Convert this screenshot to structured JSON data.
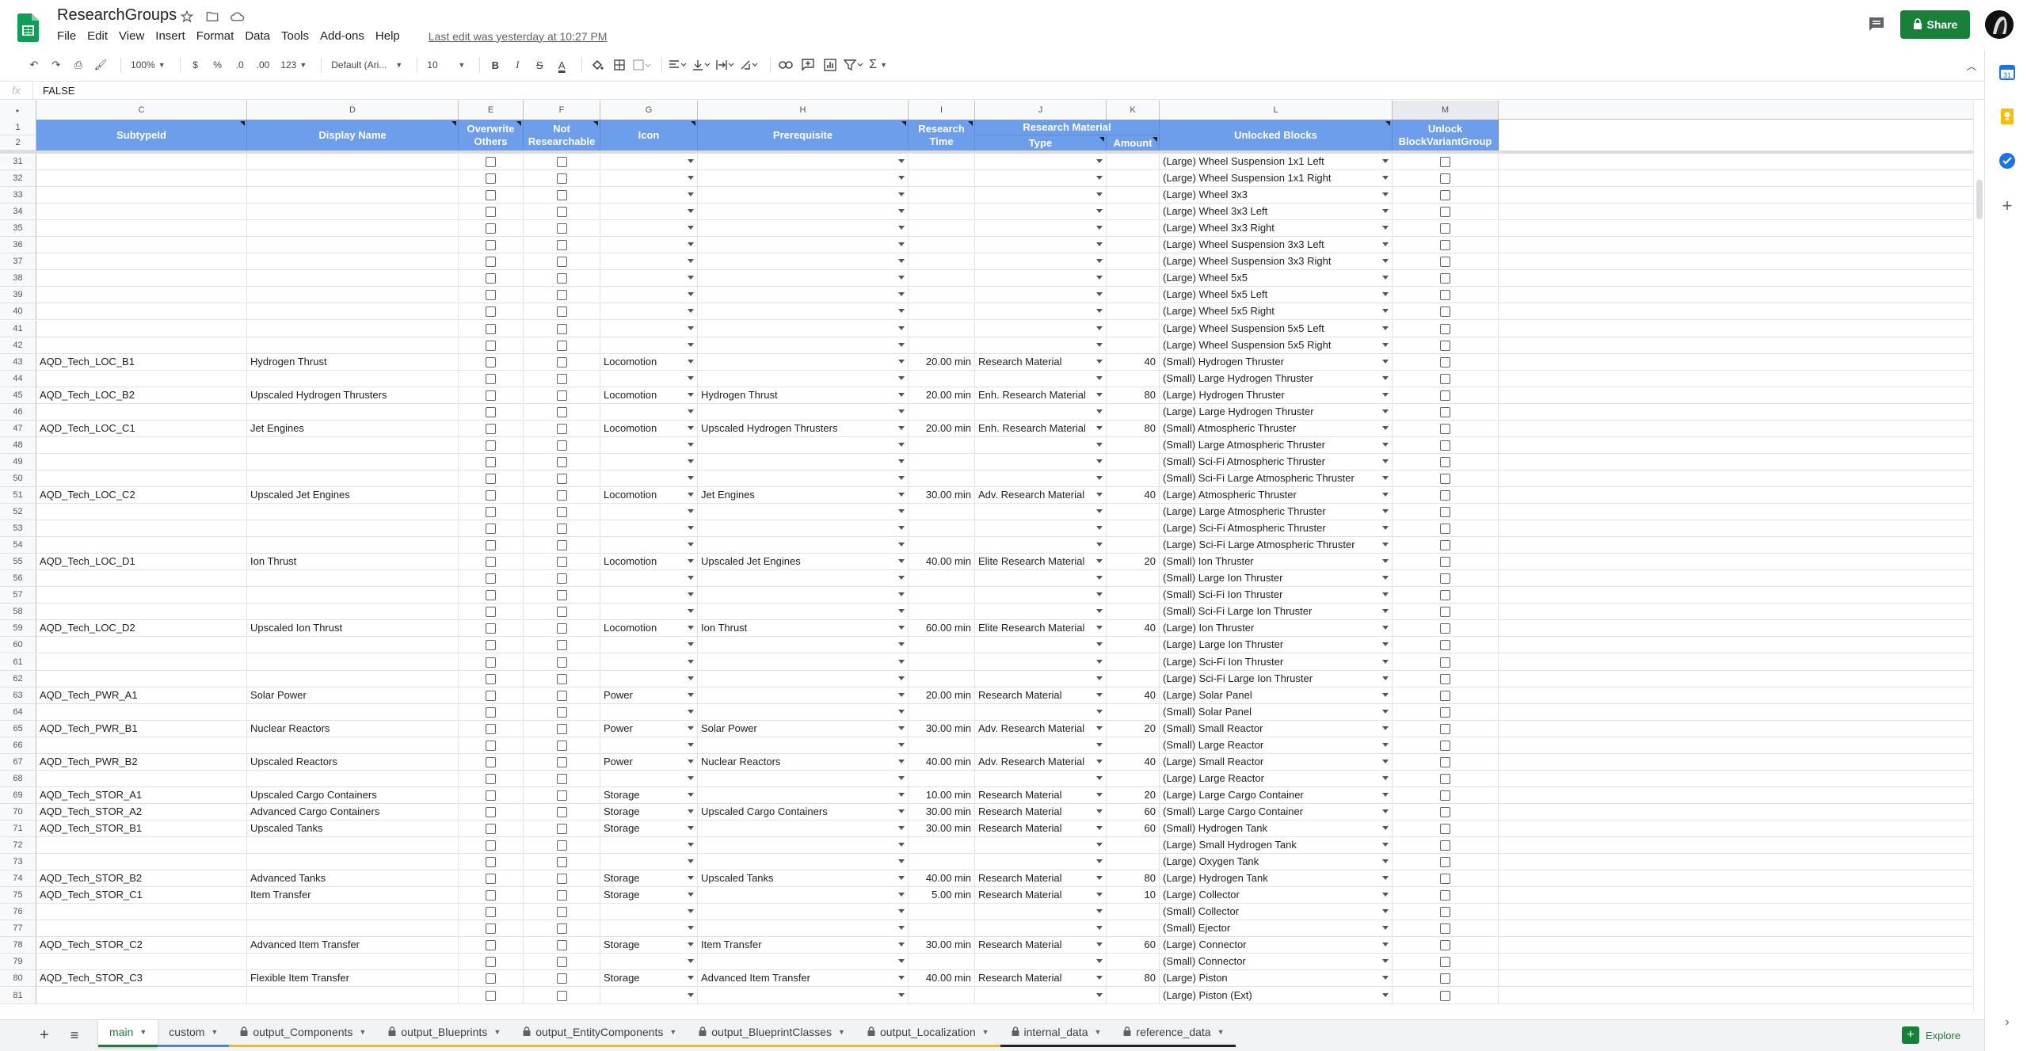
{
  "doc": {
    "title": "ResearchGroups",
    "last_edit": "Last edit was yesterday at 10:27 PM",
    "share_label": "Share"
  },
  "menu": [
    "File",
    "Edit",
    "View",
    "Insert",
    "Format",
    "Data",
    "Tools",
    "Add-ons",
    "Help"
  ],
  "toolbar": {
    "zoom": "100%",
    "currency": "$",
    "percent": "%",
    "dec_less": ".0",
    "dec_more": ".00",
    "more_formats": "123",
    "font": "Default (Ari...",
    "font_size": "10"
  },
  "formula": {
    "fx": "fx",
    "value": "FALSE"
  },
  "columns": [
    "C",
    "D",
    "E",
    "F",
    "G",
    "H",
    "I",
    "J",
    "K",
    "L",
    "M"
  ],
  "headers": {
    "subtype": "SubtypeId",
    "display": "Display Name",
    "overwrite": [
      "Overwrite",
      "Others"
    ],
    "notres": [
      "Not",
      "Researchable"
    ],
    "icon": "Icon",
    "prereq": "Prerequisite",
    "time": [
      "Research",
      "Time"
    ],
    "material_group": "Research Material",
    "type": "Type",
    "amount": "Amount",
    "unlocked": "Unlocked Blocks",
    "unlock_group": [
      "Unlock",
      "BlockVariantGroup"
    ]
  },
  "rows": [
    {
      "n": "31",
      "c": "",
      "d": "",
      "g": "",
      "h": "",
      "i": "",
      "j": "",
      "k": "",
      "l": "(Large) Wheel Suspension 1x1 Left"
    },
    {
      "n": "32",
      "c": "",
      "d": "",
      "g": "",
      "h": "",
      "i": "",
      "j": "",
      "k": "",
      "l": "(Large) Wheel Suspension 1x1 Right"
    },
    {
      "n": "33",
      "c": "",
      "d": "",
      "g": "",
      "h": "",
      "i": "",
      "j": "",
      "k": "",
      "l": "(Large) Wheel 3x3"
    },
    {
      "n": "34",
      "c": "",
      "d": "",
      "g": "",
      "h": "",
      "i": "",
      "j": "",
      "k": "",
      "l": "(Large) Wheel 3x3 Left"
    },
    {
      "n": "35",
      "c": "",
      "d": "",
      "g": "",
      "h": "",
      "i": "",
      "j": "",
      "k": "",
      "l": "(Large) Wheel 3x3 Right"
    },
    {
      "n": "36",
      "c": "",
      "d": "",
      "g": "",
      "h": "",
      "i": "",
      "j": "",
      "k": "",
      "l": "(Large) Wheel Suspension 3x3 Left"
    },
    {
      "n": "37",
      "c": "",
      "d": "",
      "g": "",
      "h": "",
      "i": "",
      "j": "",
      "k": "",
      "l": "(Large) Wheel Suspension 3x3 Right"
    },
    {
      "n": "38",
      "c": "",
      "d": "",
      "g": "",
      "h": "",
      "i": "",
      "j": "",
      "k": "",
      "l": "(Large) Wheel 5x5"
    },
    {
      "n": "39",
      "c": "",
      "d": "",
      "g": "",
      "h": "",
      "i": "",
      "j": "",
      "k": "",
      "l": "(Large) Wheel 5x5 Left"
    },
    {
      "n": "40",
      "c": "",
      "d": "",
      "g": "",
      "h": "",
      "i": "",
      "j": "",
      "k": "",
      "l": "(Large) Wheel 5x5 Right"
    },
    {
      "n": "41",
      "c": "",
      "d": "",
      "g": "",
      "h": "",
      "i": "",
      "j": "",
      "k": "",
      "l": "(Large) Wheel Suspension 5x5 Left"
    },
    {
      "n": "42",
      "c": "",
      "d": "",
      "g": "",
      "h": "",
      "i": "",
      "j": "",
      "k": "",
      "l": "(Large) Wheel Suspension 5x5 Right"
    },
    {
      "n": "43",
      "c": "AQD_Tech_LOC_B1",
      "d": "Hydrogen Thrust",
      "g": "Locomotion",
      "h": "",
      "i": "20.00 min",
      "j": "Research Material",
      "k": "40",
      "l": "(Small) Hydrogen Thruster"
    },
    {
      "n": "44",
      "c": "",
      "d": "",
      "g": "",
      "h": "",
      "i": "",
      "j": "",
      "k": "",
      "l": "(Small) Large Hydrogen Thruster"
    },
    {
      "n": "45",
      "c": "AQD_Tech_LOC_B2",
      "d": "Upscaled Hydrogen Thrusters",
      "g": "Locomotion",
      "h": "Hydrogen Thrust",
      "i": "20.00 min",
      "j": "Enh. Research Material",
      "k": "80",
      "l": "(Large) Hydrogen Thruster"
    },
    {
      "n": "46",
      "c": "",
      "d": "",
      "g": "",
      "h": "",
      "i": "",
      "j": "",
      "k": "",
      "l": "(Large) Large Hydrogen Thruster"
    },
    {
      "n": "47",
      "c": "AQD_Tech_LOC_C1",
      "d": "Jet Engines",
      "g": "Locomotion",
      "h": "Upscaled Hydrogen Thrusters",
      "i": "20.00 min",
      "j": "Enh. Research Material",
      "k": "80",
      "l": "(Small) Atmospheric Thruster"
    },
    {
      "n": "48",
      "c": "",
      "d": "",
      "g": "",
      "h": "",
      "i": "",
      "j": "",
      "k": "",
      "l": "(Small) Large Atmospheric Thruster"
    },
    {
      "n": "49",
      "c": "",
      "d": "",
      "g": "",
      "h": "",
      "i": "",
      "j": "",
      "k": "",
      "l": "(Small) Sci-Fi Atmospheric Thruster"
    },
    {
      "n": "50",
      "c": "",
      "d": "",
      "g": "",
      "h": "",
      "i": "",
      "j": "",
      "k": "",
      "l": "(Small) Sci-Fi Large Atmospheric Thruster"
    },
    {
      "n": "51",
      "c": "AQD_Tech_LOC_C2",
      "d": "Upscaled Jet Engines",
      "g": "Locomotion",
      "h": "Jet Engines",
      "i": "30.00 min",
      "j": "Adv. Research Material",
      "k": "40",
      "l": "(Large) Atmospheric Thruster"
    },
    {
      "n": "52",
      "c": "",
      "d": "",
      "g": "",
      "h": "",
      "i": "",
      "j": "",
      "k": "",
      "l": "(Large) Large Atmospheric Thruster"
    },
    {
      "n": "53",
      "c": "",
      "d": "",
      "g": "",
      "h": "",
      "i": "",
      "j": "",
      "k": "",
      "l": "(Large) Sci-Fi Atmospheric Thruster"
    },
    {
      "n": "54",
      "c": "",
      "d": "",
      "g": "",
      "h": "",
      "i": "",
      "j": "",
      "k": "",
      "l": "(Large) Sci-Fi Large Atmospheric Thruster"
    },
    {
      "n": "55",
      "c": "AQD_Tech_LOC_D1",
      "d": "Ion Thrust",
      "g": "Locomotion",
      "h": "Upscaled Jet Engines",
      "i": "40.00 min",
      "j": "Elite Research Material",
      "k": "20",
      "l": "(Small) Ion Thruster"
    },
    {
      "n": "56",
      "c": "",
      "d": "",
      "g": "",
      "h": "",
      "i": "",
      "j": "",
      "k": "",
      "l": "(Small) Large Ion Thruster"
    },
    {
      "n": "57",
      "c": "",
      "d": "",
      "g": "",
      "h": "",
      "i": "",
      "j": "",
      "k": "",
      "l": "(Small) Sci-Fi Ion Thruster"
    },
    {
      "n": "58",
      "c": "",
      "d": "",
      "g": "",
      "h": "",
      "i": "",
      "j": "",
      "k": "",
      "l": "(Small) Sci-Fi Large Ion Thruster"
    },
    {
      "n": "59",
      "c": "AQD_Tech_LOC_D2",
      "d": "Upscaled Ion Thrust",
      "g": "Locomotion",
      "h": "Ion Thrust",
      "i": "60.00 min",
      "j": "Elite Research Material",
      "k": "40",
      "l": "(Large) Ion Thruster"
    },
    {
      "n": "60",
      "c": "",
      "d": "",
      "g": "",
      "h": "",
      "i": "",
      "j": "",
      "k": "",
      "l": "(Large) Large Ion Thruster"
    },
    {
      "n": "61",
      "c": "",
      "d": "",
      "g": "",
      "h": "",
      "i": "",
      "j": "",
      "k": "",
      "l": "(Large) Sci-Fi Ion Thruster"
    },
    {
      "n": "62",
      "c": "",
      "d": "",
      "g": "",
      "h": "",
      "i": "",
      "j": "",
      "k": "",
      "l": "(Large) Sci-Fi Large Ion Thruster"
    },
    {
      "n": "63",
      "c": "AQD_Tech_PWR_A1",
      "d": "Solar Power",
      "g": "Power",
      "h": "",
      "i": "20.00 min",
      "j": "Research Material",
      "k": "40",
      "l": "(Large) Solar Panel"
    },
    {
      "n": "64",
      "c": "",
      "d": "",
      "g": "",
      "h": "",
      "i": "",
      "j": "",
      "k": "",
      "l": "(Small) Solar Panel"
    },
    {
      "n": "65",
      "c": "AQD_Tech_PWR_B1",
      "d": "Nuclear Reactors",
      "g": "Power",
      "h": "Solar Power",
      "i": "30.00 min",
      "j": "Adv. Research Material",
      "k": "20",
      "l": "(Small) Small Reactor"
    },
    {
      "n": "66",
      "c": "",
      "d": "",
      "g": "",
      "h": "",
      "i": "",
      "j": "",
      "k": "",
      "l": "(Small) Large Reactor"
    },
    {
      "n": "67",
      "c": "AQD_Tech_PWR_B2",
      "d": "Upscaled Reactors",
      "g": "Power",
      "h": "Nuclear Reactors",
      "i": "40.00 min",
      "j": "Adv. Research Material",
      "k": "40",
      "l": "(Large) Small Reactor"
    },
    {
      "n": "68",
      "c": "",
      "d": "",
      "g": "",
      "h": "",
      "i": "",
      "j": "",
      "k": "",
      "l": "(Large) Large Reactor"
    },
    {
      "n": "69",
      "c": "AQD_Tech_STOR_A1",
      "d": "Upscaled Cargo Containers",
      "g": "Storage",
      "h": "",
      "i": "10.00 min",
      "j": "Research Material",
      "k": "20",
      "l": "(Large) Large Cargo Container"
    },
    {
      "n": "70",
      "c": "AQD_Tech_STOR_A2",
      "d": "Advanced Cargo Containers",
      "g": "Storage",
      "h": "Upscaled Cargo Containers",
      "i": "30.00 min",
      "j": "Research Material",
      "k": "60",
      "l": "(Small) Large Cargo Container"
    },
    {
      "n": "71",
      "c": "AQD_Tech_STOR_B1",
      "d": "Upscaled Tanks",
      "g": "Storage",
      "h": "",
      "i": "30.00 min",
      "j": "Research Material",
      "k": "60",
      "l": "(Small) Hydrogen Tank"
    },
    {
      "n": "72",
      "c": "",
      "d": "",
      "g": "",
      "h": "",
      "i": "",
      "j": "",
      "k": "",
      "l": "(Large) Small Hydrogen Tank"
    },
    {
      "n": "73",
      "c": "",
      "d": "",
      "g": "",
      "h": "",
      "i": "",
      "j": "",
      "k": "",
      "l": "(Large) Oxygen Tank"
    },
    {
      "n": "74",
      "c": "AQD_Tech_STOR_B2",
      "d": "Advanced Tanks",
      "g": "Storage",
      "h": "Upscaled Tanks",
      "i": "40.00 min",
      "j": "Research Material",
      "k": "80",
      "l": "(Large) Hydrogen Tank"
    },
    {
      "n": "75",
      "c": "AQD_Tech_STOR_C1",
      "d": "Item Transfer",
      "g": "Storage",
      "h": "",
      "i": "5.00 min",
      "j": "Research Material",
      "k": "10",
      "l": "(Large) Collector"
    },
    {
      "n": "76",
      "c": "",
      "d": "",
      "g": "",
      "h": "",
      "i": "",
      "j": "",
      "k": "",
      "l": "(Small) Collector"
    },
    {
      "n": "77",
      "c": "",
      "d": "",
      "g": "",
      "h": "",
      "i": "",
      "j": "",
      "k": "",
      "l": "(Small) Ejector"
    },
    {
      "n": "78",
      "c": "AQD_Tech_STOR_C2",
      "d": "Advanced Item Transfer",
      "g": "Storage",
      "h": "Item Transfer",
      "i": "30.00 min",
      "j": "Research Material",
      "k": "60",
      "l": "(Large) Connector"
    },
    {
      "n": "79",
      "c": "",
      "d": "",
      "g": "",
      "h": "",
      "i": "",
      "j": "",
      "k": "",
      "l": "(Small) Connector"
    },
    {
      "n": "80",
      "c": "AQD_Tech_STOR_C3",
      "d": "Flexible Item Transfer",
      "g": "Storage",
      "h": "Advanced Item Transfer",
      "i": "40.00 min",
      "j": "Research Material",
      "k": "80",
      "l": "(Large) Piston"
    },
    {
      "n": "81",
      "c": "",
      "d": "",
      "g": "",
      "h": "",
      "i": "",
      "j": "",
      "k": "",
      "l": "(Large) Piston (Ext)"
    }
  ],
  "sheets": [
    {
      "label": "main",
      "locked": false,
      "active": true,
      "accent": ""
    },
    {
      "label": "custom",
      "locked": false,
      "active": false,
      "accent": "blue"
    },
    {
      "label": "output_Components",
      "locked": true,
      "active": false,
      "accent": "gold"
    },
    {
      "label": "output_Blueprints",
      "locked": true,
      "active": false,
      "accent": "gold"
    },
    {
      "label": "output_EntityComponents",
      "locked": true,
      "active": false,
      "accent": "gold"
    },
    {
      "label": "output_BlueprintClasses",
      "locked": true,
      "active": false,
      "accent": "gold"
    },
    {
      "label": "output_Localization",
      "locked": true,
      "active": false,
      "accent": "gold"
    },
    {
      "label": "internal_data",
      "locked": true,
      "active": false,
      "accent": "black"
    },
    {
      "label": "reference_data",
      "locked": true,
      "active": false,
      "accent": "black"
    }
  ],
  "explore_label": "Explore",
  "colors": {
    "header_bg": "#6d9eeb",
    "share_green": "#188038",
    "accent": "#188038"
  }
}
